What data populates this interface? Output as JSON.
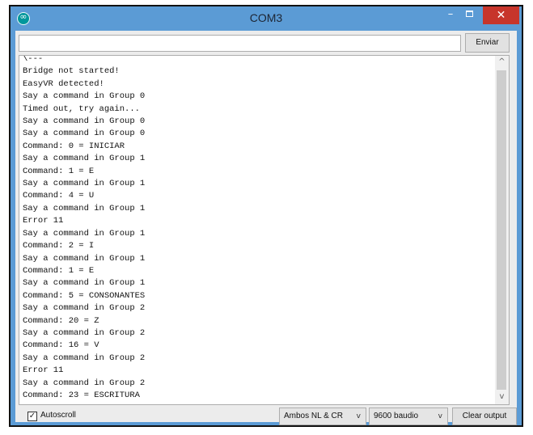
{
  "window": {
    "title": "COM3",
    "minimize_glyph": "–",
    "close_glyph": "✕",
    "accent_color": "#5b9bd5",
    "close_color": "#c7352b"
  },
  "send_bar": {
    "input_value": "",
    "send_label": "Enviar"
  },
  "output_lines": [
    "\\---",
    "Bridge not started!",
    "EasyVR detected!",
    "Say a command in Group 0",
    "Timed out, try again...",
    "Say a command in Group 0",
    "Say a command in Group 0",
    "Command: 0 = INICIAR",
    "Say a command in Group 1",
    "Command: 1 = E",
    "Say a command in Group 1",
    "Command: 4 = U",
    "Say a command in Group 1",
    "Error 11",
    "Say a command in Group 1",
    "Command: 2 = I",
    "Say a command in Group 1",
    "Command: 1 = E",
    "Say a command in Group 1",
    "Command: 5 = CONSONANTES",
    "Say a command in Group 2",
    "Command: 20 = Z",
    "Say a command in Group 2",
    "Command: 16 = V",
    "Say a command in Group 2",
    "Error 11",
    "Say a command in Group 2",
    "Command: 23 = ESCRITURA"
  ],
  "scrollbar": {
    "up_glyph": "^",
    "down_glyph": "v"
  },
  "bottom_bar": {
    "autoscroll_label": "Autoscroll",
    "autoscroll_checked": true,
    "checkmark_glyph": "✓",
    "line_ending": "Ambos NL & CR",
    "baud_rate": "9600 baudio",
    "chevron_glyph": "v",
    "clear_label": "Clear output"
  }
}
